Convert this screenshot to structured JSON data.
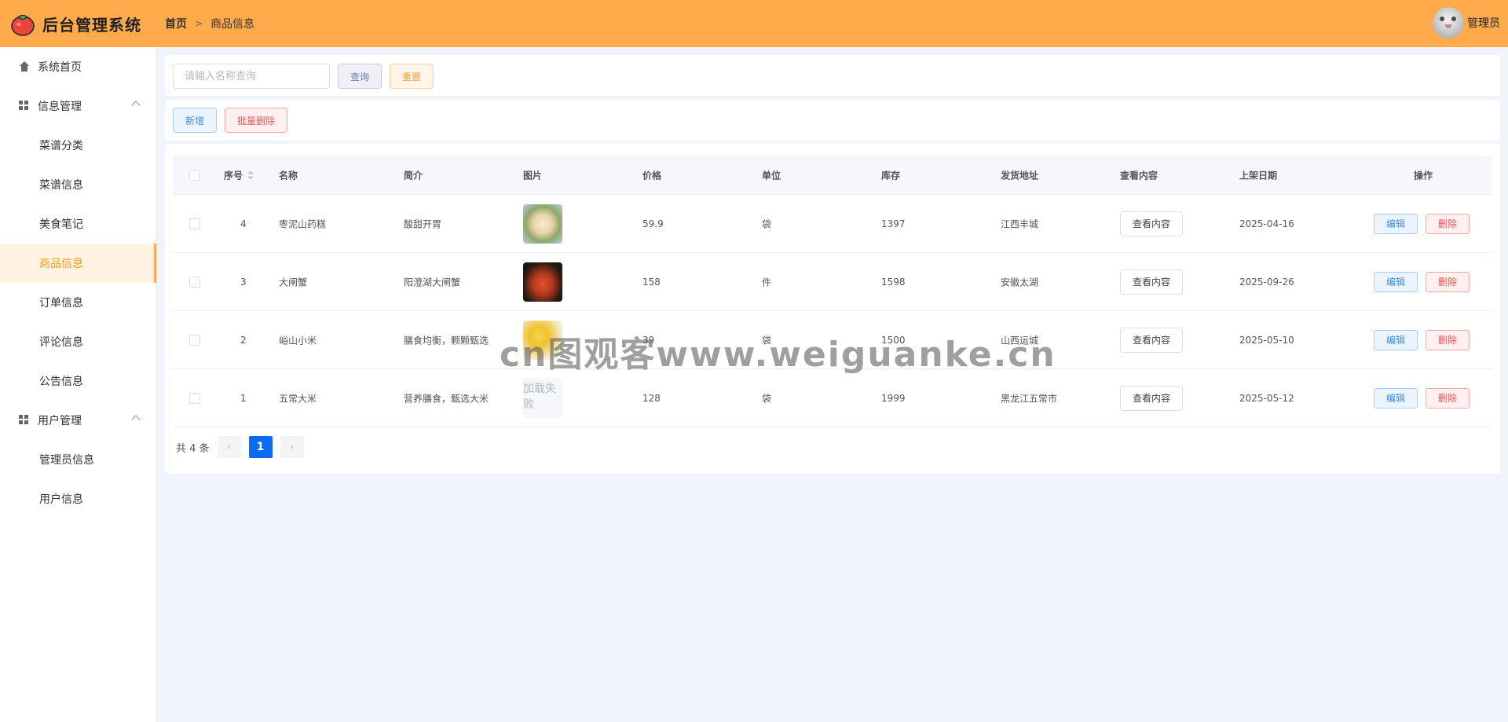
{
  "app": {
    "title": "后台管理系统"
  },
  "breadcrumb": {
    "home": "首页",
    "current": "商品信息"
  },
  "user": {
    "name": "管理员"
  },
  "sidebar": {
    "home": "系统首页",
    "groups": [
      {
        "label": "信息管理",
        "items": [
          "菜谱分类",
          "菜谱信息",
          "美食笔记",
          "商品信息",
          "订单信息",
          "评论信息",
          "公告信息"
        ]
      },
      {
        "label": "用户管理",
        "items": [
          "管理员信息",
          "用户信息"
        ]
      }
    ],
    "active": "商品信息"
  },
  "search": {
    "placeholder": "请输入名称查询",
    "value": "",
    "query_label": "查询",
    "reset_label": "重置"
  },
  "actions": {
    "add_label": "新增",
    "batch_delete_label": "批量删除"
  },
  "table": {
    "columns": [
      "序号",
      "名称",
      "简介",
      "图片",
      "价格",
      "单位",
      "库存",
      "发货地址",
      "查看内容",
      "上架日期",
      "操作"
    ],
    "rows": [
      {
        "id": "4",
        "name": "枣泥山药糕",
        "desc": "酸甜开胃",
        "image": "pastry-photo",
        "price": "59.9",
        "unit": "袋",
        "stock": "1397",
        "address": "江西丰城",
        "view": "查看内容",
        "date": "2025-04-16",
        "edit": "编辑",
        "delete": "删除"
      },
      {
        "id": "3",
        "name": "大闸蟹",
        "desc": "阳澄湖大闸蟹",
        "image": "crab-photo",
        "price": "158",
        "unit": "件",
        "stock": "1598",
        "address": "安徽太湖",
        "view": "查看内容",
        "date": "2025-09-26",
        "edit": "编辑",
        "delete": "删除"
      },
      {
        "id": "2",
        "name": "峪山小米",
        "desc": "膳食均衡，颗颗甄选",
        "image": "millet-photo",
        "price": "39",
        "unit": "袋",
        "stock": "1500",
        "address": "山西运城",
        "view": "查看内容",
        "date": "2025-05-10",
        "edit": "编辑",
        "delete": "删除"
      },
      {
        "id": "1",
        "name": "五常大米",
        "desc": "营养膳食，甄选大米",
        "image_fail_text": "加载失败",
        "price": "128",
        "unit": "袋",
        "stock": "1999",
        "address": "黑龙江五常市",
        "view": "查看内容",
        "date": "2025-05-12",
        "edit": "编辑",
        "delete": "删除"
      }
    ]
  },
  "pagination": {
    "total_text": "共 4 条",
    "current_page": "1",
    "prev": "‹",
    "next": "›"
  },
  "watermark": "cn图观客www.weiguanke.cn",
  "colors": {
    "header": "#ffaa4b",
    "accent": "#ff9a1a",
    "primary": "#0a6cf5"
  }
}
